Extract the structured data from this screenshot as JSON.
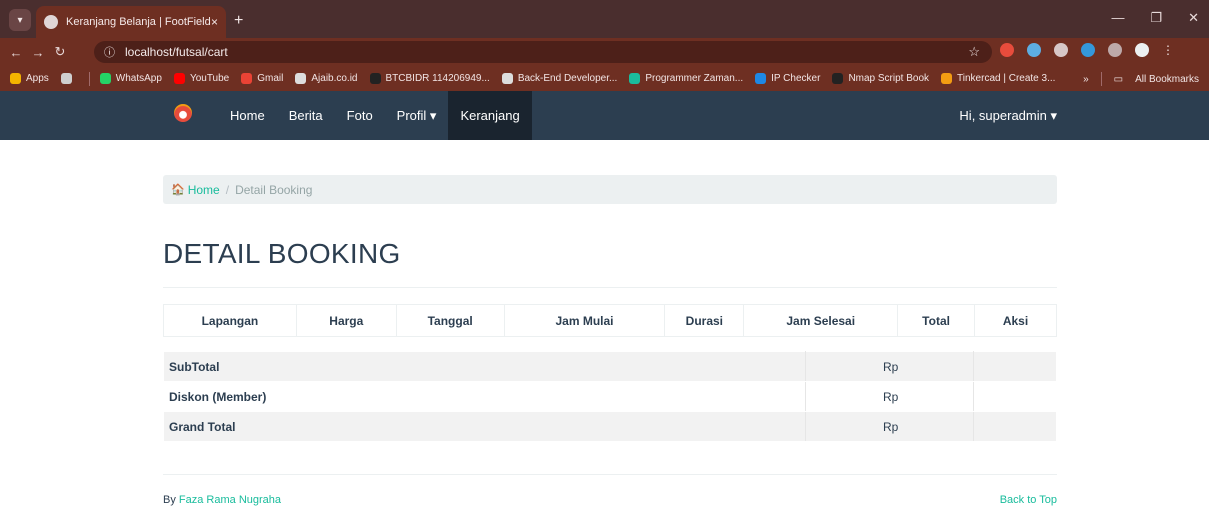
{
  "browser": {
    "tab_title": "Keranjang Belanja | FootField",
    "tab_close": "×",
    "new_tab": "+",
    "url": "localhost/futsal/cart",
    "bookmarks": [
      {
        "label": "Apps",
        "color": "#f4b400"
      },
      {
        "label": "WhatsApp",
        "color": "#25d366"
      },
      {
        "label": "YouTube",
        "color": "#ff0000"
      },
      {
        "label": "Gmail",
        "color": "#ea4335"
      },
      {
        "label": "Ajaib.co.id",
        "color": "#dddddd"
      },
      {
        "label": "BTCBIDR 114206949...",
        "color": "#222222"
      },
      {
        "label": "Back-End Developer...",
        "color": "#dddddd"
      },
      {
        "label": "Programmer Zaman...",
        "color": "#1abc9c"
      },
      {
        "label": "IP Checker",
        "color": "#1e88e5"
      },
      {
        "label": "Nmap Script Book",
        "color": "#222222"
      },
      {
        "label": "Tinkercad | Create 3...",
        "color": "#f39c12"
      }
    ],
    "more_bookmarks": "»",
    "all_bookmarks": "All Bookmarks"
  },
  "navbar": {
    "items": [
      "Home",
      "Berita",
      "Foto",
      "Profil ▾",
      "Keranjang"
    ],
    "user": "Hi, superadmin ▾"
  },
  "breadcrumb": {
    "home": "Home",
    "separator": "/",
    "current": "Detail Booking"
  },
  "page_title": "DETAIL BOOKING",
  "table": {
    "headers": [
      "Lapangan",
      "Harga",
      "Tanggal",
      "Jam Mulai",
      "Durasi",
      "Jam Selesai",
      "Total",
      "Aksi"
    ]
  },
  "totals": [
    {
      "label": "SubTotal",
      "amount": "Rp"
    },
    {
      "label": "Diskon (Member)",
      "amount": "Rp"
    },
    {
      "label": "Grand Total",
      "amount": "Rp"
    }
  ],
  "footer": {
    "by": "By",
    "author": "Faza Rama Nugraha",
    "back_to_top": "Back to Top"
  }
}
